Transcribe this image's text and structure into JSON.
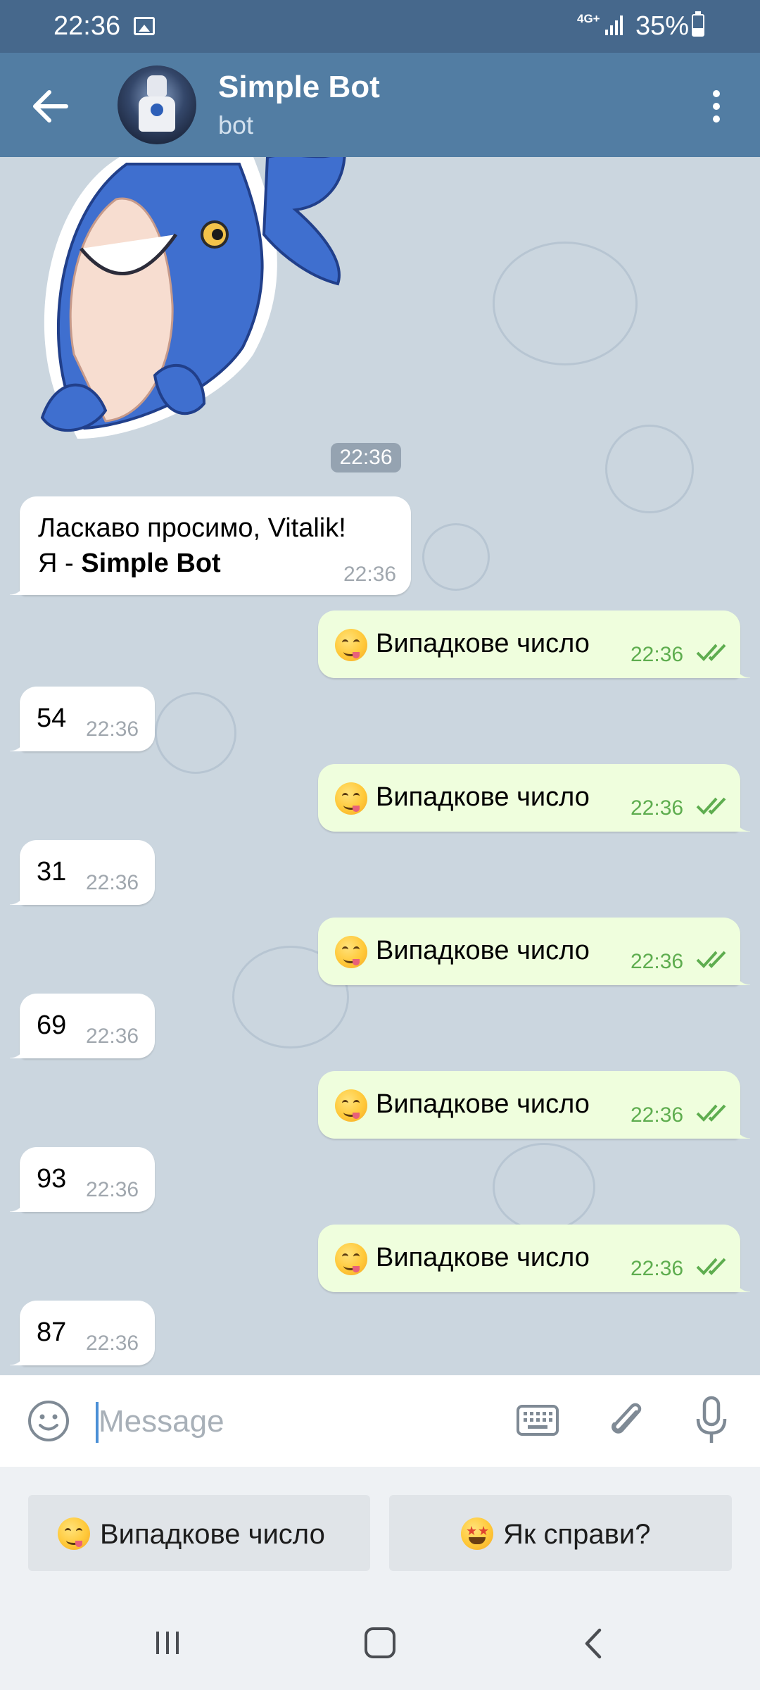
{
  "status_bar": {
    "time": "22:36",
    "network": "4G+",
    "battery": "35%"
  },
  "header": {
    "title": "Simple Bot",
    "subtitle": "bot",
    "background": "#527da3"
  },
  "sticker": {
    "time": "22:36",
    "icon": "shark-sticker"
  },
  "messages": [
    {
      "dir": "in",
      "line1": "Ласкаво просимо, Vitalik!",
      "prefix": "Я - ",
      "bold": "Simple Bot",
      "time": "22:36"
    },
    {
      "dir": "out",
      "text": "Випадкове число",
      "time": "22:36",
      "emoji": "yum-face"
    },
    {
      "dir": "in",
      "text": "54",
      "time": "22:36"
    },
    {
      "dir": "out",
      "text": "Випадкове число",
      "time": "22:36",
      "emoji": "yum-face"
    },
    {
      "dir": "in",
      "text": "31",
      "time": "22:36"
    },
    {
      "dir": "out",
      "text": "Випадкове число",
      "time": "22:36",
      "emoji": "yum-face"
    },
    {
      "dir": "in",
      "text": "69",
      "time": "22:36"
    },
    {
      "dir": "out",
      "text": "Випадкове число",
      "time": "22:36",
      "emoji": "yum-face"
    },
    {
      "dir": "in",
      "text": "93",
      "time": "22:36"
    },
    {
      "dir": "out",
      "text": "Випадкове число",
      "time": "22:36",
      "emoji": "yum-face"
    },
    {
      "dir": "in",
      "text": "87",
      "time": "22:36"
    }
  ],
  "input": {
    "placeholder": "Message",
    "value": ""
  },
  "reply_keyboard": {
    "buttons": [
      {
        "label": "Випадкове число",
        "emoji": "yum-face"
      },
      {
        "label": "Як справи?",
        "emoji": "star-struck-face"
      }
    ]
  },
  "colors": {
    "status_bar": "#46688c",
    "chat_background": "#cbd6df",
    "outgoing_bubble": "#effedd",
    "incoming_bubble": "#ffffff",
    "read_checks": "#5ead4f"
  }
}
